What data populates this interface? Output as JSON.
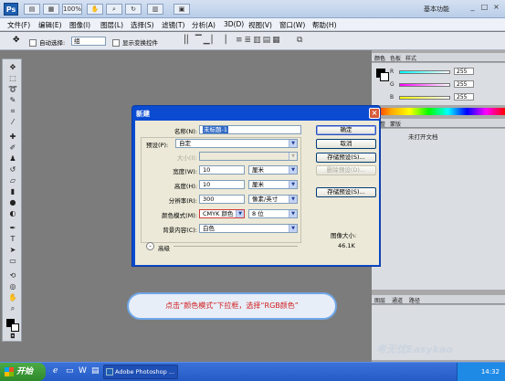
{
  "titlebar": {
    "logo": "Ps",
    "zoom": "100%",
    "workspace": "基本功能",
    "buttons": [
      "_",
      "□",
      "×"
    ]
  },
  "menubar": [
    "文件(F)",
    "编辑(E)",
    "图像(I)",
    "图层(L)",
    "选择(S)",
    "滤镜(T)",
    "分析(A)",
    "3D(D)",
    "视图(V)",
    "窗口(W)",
    "帮助(H)"
  ],
  "options": {
    "auto_select_label": "自动选择:",
    "auto_select_value": "组",
    "show_transform_label": "显示变换控件"
  },
  "color_panel": {
    "tabs": [
      "颜色",
      "色板",
      "样式"
    ],
    "channels": [
      {
        "name": "R",
        "value": "255"
      },
      {
        "name": "G",
        "value": "255"
      },
      {
        "name": "B",
        "value": "255"
      }
    ]
  },
  "adjust_panel": {
    "tabs": [
      "调整",
      "蒙版"
    ],
    "text": "未打开文档"
  },
  "layers_panel": {
    "tabs": [
      "图层",
      "通道",
      "路径"
    ]
  },
  "dialog": {
    "title": "新建",
    "close": "×",
    "name_label": "名称(N):",
    "name_value": "未标题-1",
    "preset_label": "预设(P):",
    "preset_value": "自定",
    "size_label": "大小(I):",
    "width_label": "宽度(W):",
    "width_value": "10",
    "width_unit": "厘米",
    "height_label": "高度(H):",
    "height_value": "10",
    "height_unit": "厘米",
    "resolution_label": "分辨率(R):",
    "resolution_value": "300",
    "resolution_unit": "像素/英寸",
    "color_mode_label": "颜色模式(M):",
    "color_mode_value": "CMYK 颜色",
    "bit_depth_value": "8 位",
    "bg_label": "背景内容(C):",
    "bg_value": "白色",
    "advanced_label": "高级",
    "image_size_label": "图像大小:",
    "image_size_value": "46.1K",
    "buttons": {
      "ok": "确定",
      "cancel": "取消",
      "save_preset": "存储预设(S)...",
      "delete_preset": "删除预设(D)...",
      "device_central": "存储预设(S)..."
    }
  },
  "callout": "点击“颜色模式”下拉框，选择“RGB颜色”",
  "watermark": "考无忧Easykao",
  "taskbar": {
    "start": "开始",
    "task": "Adobe Photoshop ...",
    "clock": "14:32"
  },
  "colors": {
    "dialog_title": "#0a4bd1",
    "callout_text": "#d21c1c",
    "taskbar": "#245bc6"
  }
}
